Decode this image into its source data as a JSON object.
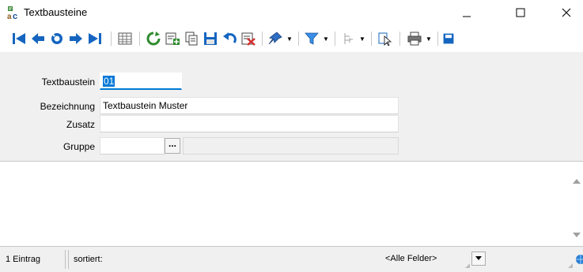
{
  "window": {
    "title": "Textbausteine",
    "minimize_glyph": "—",
    "maximize_glyph": "☐",
    "close_glyph": "✕"
  },
  "toolbar": {
    "buttons": [
      {
        "name": "first-record-button",
        "icon": "first-record-icon"
      },
      {
        "name": "previous-record-button",
        "icon": "arrow-left-icon"
      },
      {
        "name": "search-button",
        "icon": "search-icon"
      },
      {
        "name": "next-record-button",
        "icon": "arrow-right-icon"
      },
      {
        "name": "last-record-button",
        "icon": "last-record-icon"
      },
      {
        "name": "table-view-button",
        "icon": "table-icon"
      },
      {
        "name": "refresh-button",
        "icon": "refresh-icon"
      },
      {
        "name": "new-record-button",
        "icon": "new-record-icon"
      },
      {
        "name": "copy-record-button",
        "icon": "copy-icon"
      },
      {
        "name": "save-button",
        "icon": "save-icon"
      },
      {
        "name": "undo-button",
        "icon": "undo-icon"
      },
      {
        "name": "delete-button",
        "icon": "delete-icon"
      },
      {
        "name": "pin-button",
        "icon": "pin-icon"
      },
      {
        "name": "filter-button",
        "icon": "filter-icon"
      },
      {
        "name": "tree-button",
        "icon": "tree-icon"
      },
      {
        "name": "select-button",
        "icon": "cursor-select-icon"
      },
      {
        "name": "print-button",
        "icon": "printer-icon"
      },
      {
        "name": "export-button",
        "icon": "export-icon"
      }
    ],
    "dropdown_glyph": "▼"
  },
  "form": {
    "textbaustein_label": "Textbaustein",
    "textbaustein_value": "01",
    "bezeichnung_label": "Bezeichnung",
    "bezeichnung_value": "Textbaustein Muster",
    "zusatz_label": "Zusatz",
    "zusatz_value": "",
    "gruppe_label": "Gruppe",
    "gruppe_value": "",
    "gruppe_browse_label": "...",
    "gruppe_description": ""
  },
  "memo": {
    "content": ""
  },
  "statusbar": {
    "count": "1 Eintrag",
    "sorted_label": "sortiert:",
    "field_filter_value": "<Alle Felder>",
    "search_value": ""
  },
  "colors": {
    "accent": "#0078d7",
    "toolbar_blue": "#1565c0",
    "refresh_green": "#2e8b2e",
    "delete_red": "#d32f2f"
  }
}
